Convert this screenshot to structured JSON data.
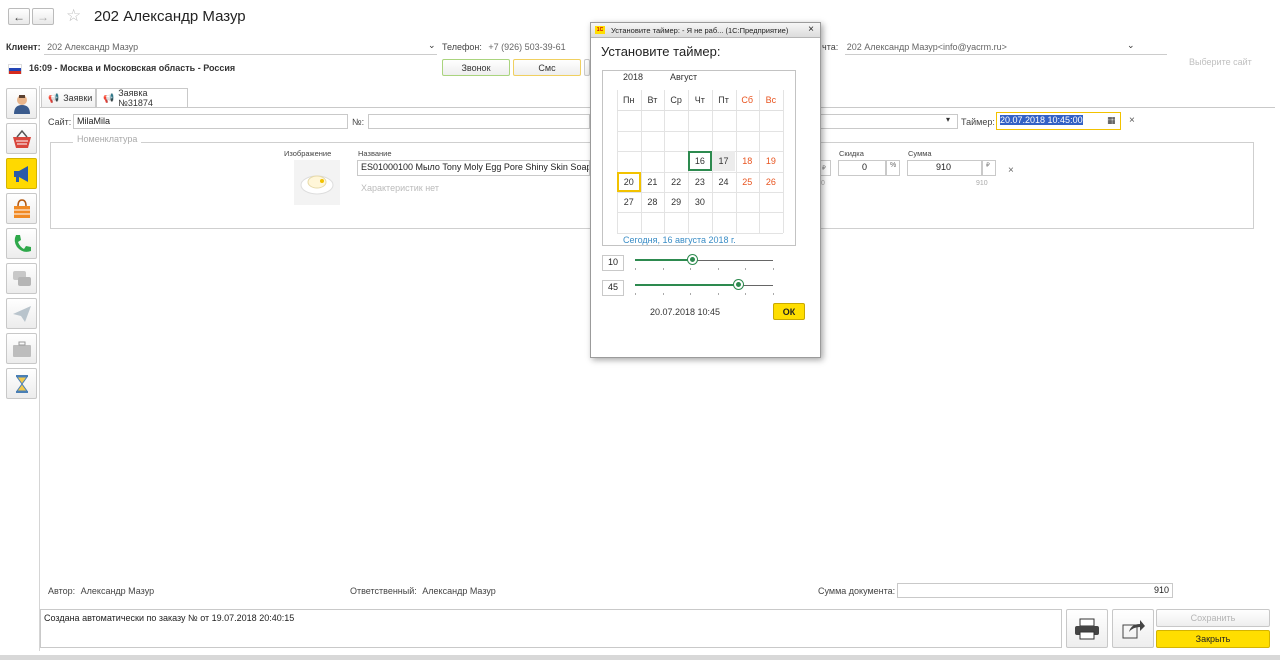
{
  "header": {
    "title": "202 Александр Мазур",
    "client_label": "Клиент:",
    "client_value": "202 Александр Мазур",
    "phone_label": "Телефон:",
    "phone_value": "+7 (926) 503-39-61",
    "email_label_partial": "чта:",
    "email_value": "202 Александр Мазур<info@yacrm.ru>",
    "time_region": "16:09 - Москва и Московская область - Россия",
    "select_site": "Выберите сайт"
  },
  "actions": {
    "call": "Звонок",
    "sms": "Смс"
  },
  "tabs": [
    {
      "label": "Заявки"
    },
    {
      "label": "Заявка №31874"
    }
  ],
  "form": {
    "site_label": "Сайт:",
    "site_value": "MilaMila",
    "number_label": "№:",
    "timer_label": "Таймер:",
    "timer_value": "20.07.2018 10:45:00"
  },
  "nomenclature": {
    "group_label": "Номенклатура",
    "image_label": "Изображение",
    "name_label": "Название",
    "name_value": "ES01000100 Мыло Tony Moly Egg Pore Shiny Skin Soap",
    "no_characteristics": "Характеристик нет",
    "discount_label": "Скидка",
    "discount_value": "0",
    "percent_sign": "%",
    "sum_label": "Сумма",
    "sum_value": "910",
    "currency": "₽",
    "sum_sub": "910",
    "price_sub": "0"
  },
  "footer": {
    "author_label": "Автор:",
    "author_value": "Александр Мазур",
    "responsible_label": "Ответственный:",
    "responsible_value": "Александр Мазур",
    "doc_sum_label": "Сумма документа:",
    "doc_sum_value": "910",
    "comment": "Создана автоматически по заказу № от 19.07.2018 20:40:15",
    "save": "Сохранить",
    "close": "Закрыть"
  },
  "dialog": {
    "window_title": "Установите таймер: - Я не раб... (1С:Предприятие)",
    "heading": "Установите таймер:",
    "year": "2018",
    "month": "Август",
    "weekdays": [
      "Пн",
      "Вт",
      "Ср",
      "Чт",
      "Пт",
      "Сб",
      "Вс"
    ],
    "week1": [
      "",
      "",
      "",
      "16",
      "17",
      "18",
      "19"
    ],
    "week2": [
      "20",
      "21",
      "22",
      "23",
      "24",
      "25",
      "26"
    ],
    "week3": [
      "27",
      "28",
      "29",
      "30",
      "",
      "",
      ""
    ],
    "today_link": "Сегодня, 16 августа 2018 г.",
    "hour": "10",
    "minute": "45",
    "result": "20.07.2018 10:45",
    "ok": "ОК",
    "hour_level": 0.42,
    "minute_level": 0.75
  },
  "colors": {
    "accent_yellow": "#ffde00",
    "weekend_red": "#e8541f",
    "link_blue": "#3a8dc6",
    "green": "#2d8a4f"
  }
}
